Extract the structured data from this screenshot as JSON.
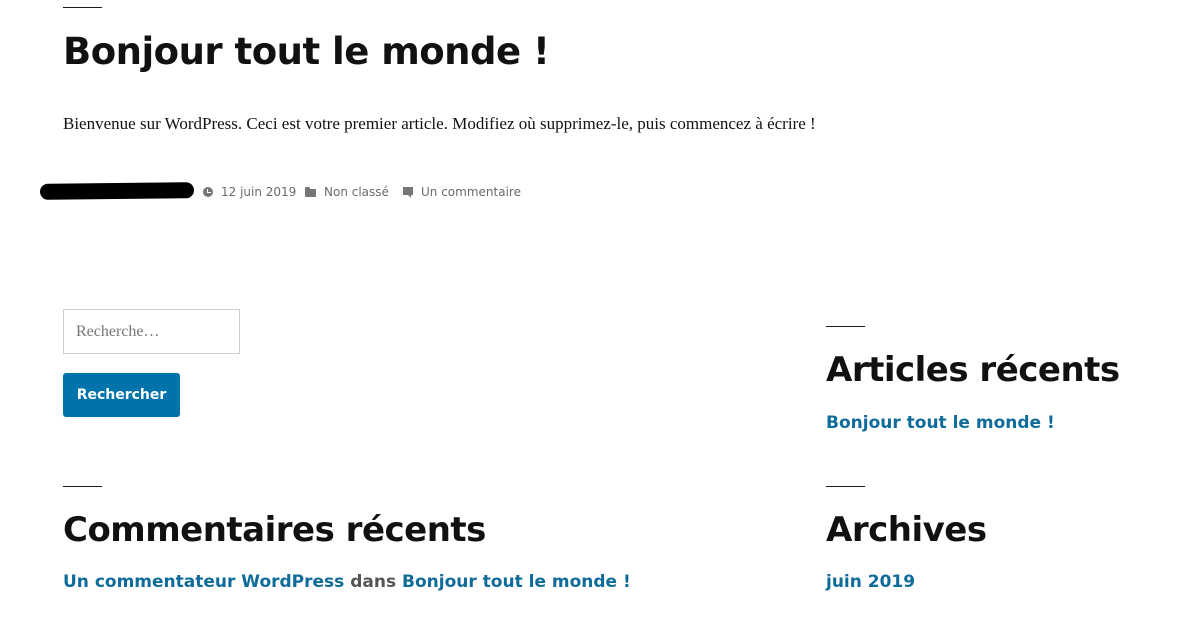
{
  "post": {
    "title": "Bonjour tout le monde !",
    "excerpt": "Bienvenue sur WordPress. Ceci est votre premier article. Modifiez où supprimez-le, puis commencez à écrire !",
    "meta": {
      "date": "12 juin 2019",
      "category": "Non classé",
      "comments": "Un commentaire"
    }
  },
  "search": {
    "placeholder": "Recherche…",
    "button_label": "Rechercher"
  },
  "widgets": {
    "recent_posts": {
      "title": "Articles récents",
      "items": [
        "Bonjour tout le monde !"
      ]
    },
    "recent_comments": {
      "title": "Commentaires récents",
      "items": [
        {
          "author": "Un commentateur WordPress",
          "connector": "dans",
          "post": "Bonjour tout le monde !"
        }
      ]
    },
    "archives": {
      "title": "Archives",
      "items": [
        "juin 2019"
      ]
    }
  },
  "icons": {
    "date": "clock-icon",
    "category": "folder-icon",
    "comments": "comment-icon"
  },
  "colors": {
    "link": "#0f6b9a",
    "button": "#0073aa",
    "meta_text": "#6b6b6b"
  }
}
